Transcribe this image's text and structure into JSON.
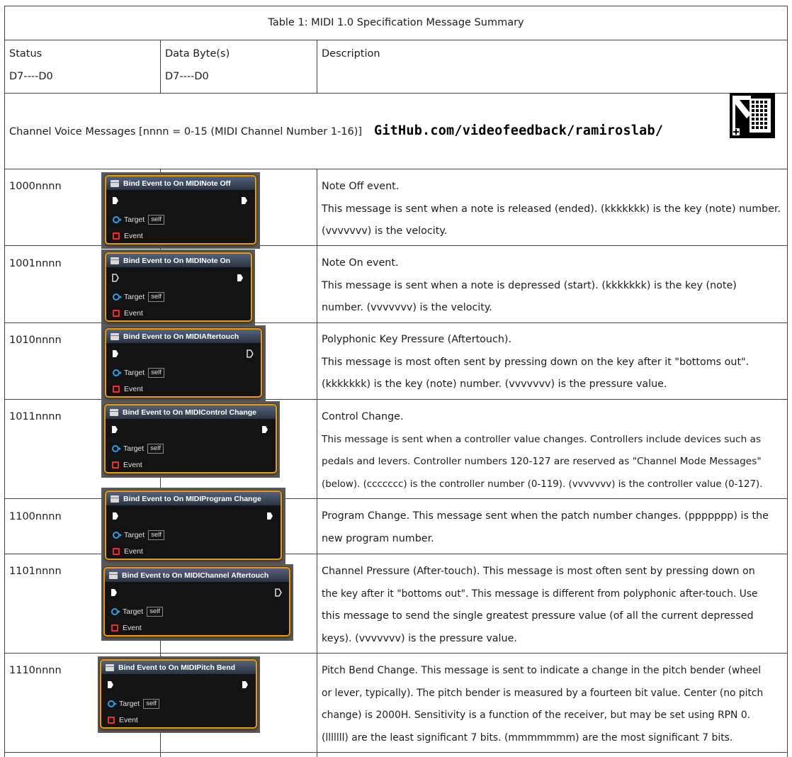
{
  "table": {
    "caption": "Table 1: MIDI 1.0 Specification Message Summary",
    "headers": {
      "status_label": "Status",
      "status_sub": "D7----D0",
      "data_label": "Data Byte(s)",
      "data_sub": "D7----D0",
      "desc_label": "Description"
    },
    "section": "Channel Voice Messages [nnnn = 0-15 (MIDI Channel Number 1-16)]"
  },
  "banner": {
    "github": "GitHub.com/videofeedback/ramiroslab/",
    "logo_icon": "ramiroslab-logo-icon"
  },
  "node_common": {
    "target_label": "Target",
    "self_label": "self",
    "event_label": "Event"
  },
  "rows": [
    {
      "status": "1000nnnn",
      "node_title": "Bind Event to On MIDINote Off",
      "desc_lines": [
        "Note Off event.",
        "This message is sent when a note is released (ended). (kkkkkkk) is the key (note) number.",
        "(vvvvvvv) is the velocity."
      ]
    },
    {
      "status": "1001nnnn",
      "node_title": "Bind Event to On MIDINote On",
      "desc_lines": [
        "Note On event.",
        "This message is sent when a note is depressed (start). (kkkkkkk) is the key (note)",
        "number. (vvvvvvv) is the velocity."
      ]
    },
    {
      "status": "1010nnnn",
      "node_title": "Bind Event to On MIDIAftertouch",
      "desc_lines": [
        "Polyphonic Key Pressure (Aftertouch).",
        "This message is most often sent by pressing down on the key after it \"bottoms out\".",
        "(kkkkkkk) is the key (note) number. (vvvvvvv) is the pressure value."
      ]
    },
    {
      "status": "1011nnnn",
      "node_title": "Bind Event to On MIDIControl Change",
      "desc_lines": [
        "Control Change.",
        "This message is sent when a controller value changes. Controllers include devices such as",
        "pedals and levers. Controller numbers 120-127 are reserved as \"Channel Mode Messages\"",
        "(below). (ccccccc) is the controller number (0-119). (vvvvvvv) is the controller value (0-127)."
      ]
    },
    {
      "status": "1100nnnn",
      "node_title": "Bind Event to On MIDIProgram Change",
      "desc_lines": [
        "Program Change. This message sent when the patch number changes. (ppppppp) is the",
        "new program number."
      ]
    },
    {
      "status": "1101nnnn",
      "node_title": "Bind Event to On MIDIChannel Aftertouch",
      "desc_lines": [
        "Channel Pressure (After-touch). This message is most often sent by pressing down on",
        "the key after it \"bottoms out\". This message is different from polyphonic after-touch. Use",
        "this message to send the single greatest pressure value (of all the current depressed",
        "keys). (vvvvvvv) is the pressure value."
      ]
    },
    {
      "status": "1110nnnn",
      "node_title": "Bind Event to On MIDIPitch Bend",
      "desc_lines": [
        "Pitch Bend Change. This message is sent to indicate a change in the pitch bender (wheel",
        "or lever, typically). The pitch bender is measured by a fourteen bit value. Center (no pitch",
        "change) is 2000H. Sensitivity is a function of the receiver, but may be set using RPN 0.",
        "(lllllll) are the least significant 7 bits. (mmmmmmm) are the most significant 7 bits."
      ]
    }
  ]
}
